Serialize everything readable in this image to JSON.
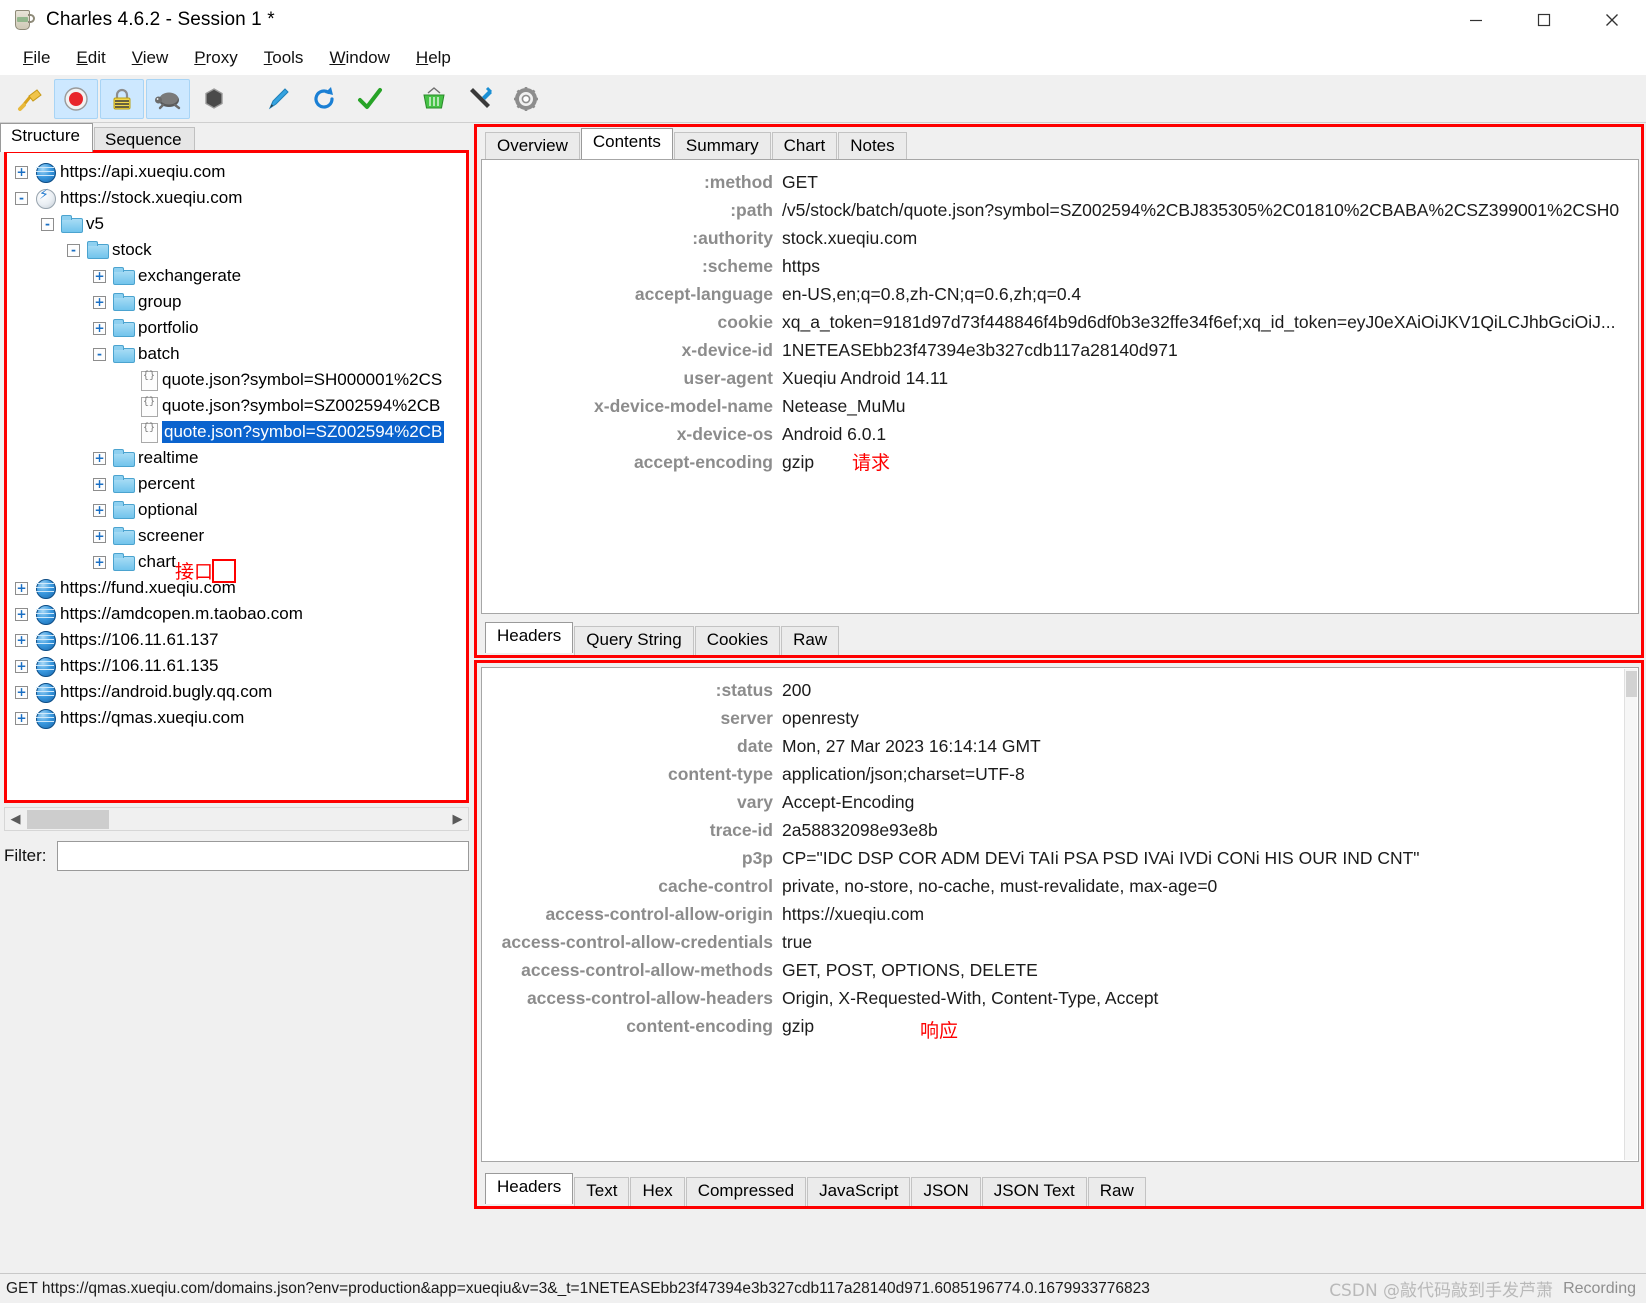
{
  "window": {
    "title": "Charles 4.6.2 - Session 1 *",
    "app_icon": "charles-jar-icon",
    "minimize": "minimize-button",
    "maximize": "maximize-button",
    "close": "close-button"
  },
  "menubar": [
    {
      "label": "File",
      "mnemonic": "F"
    },
    {
      "label": "Edit",
      "mnemonic": "E"
    },
    {
      "label": "View",
      "mnemonic": "V"
    },
    {
      "label": "Proxy",
      "mnemonic": "P"
    },
    {
      "label": "Tools",
      "mnemonic": "T"
    },
    {
      "label": "Window",
      "mnemonic": "W"
    },
    {
      "label": "Help",
      "mnemonic": "H"
    }
  ],
  "toolbar": [
    {
      "name": "clear-session-icon",
      "glyph": "🧹",
      "active": false
    },
    {
      "name": "record-icon",
      "glyph": "⏺",
      "active": true
    },
    {
      "name": "ssl-proxying-icon",
      "glyph": "🔒",
      "active": true
    },
    {
      "name": "throttle-icon",
      "glyph": "🐢",
      "active": true
    },
    {
      "name": "breakpoints-icon",
      "glyph": "⬣",
      "active": false
    },
    {
      "name": "compose-icon",
      "glyph": "🖊",
      "active": false
    },
    {
      "name": "repeat-icon",
      "glyph": "↻",
      "active": false
    },
    {
      "name": "validate-icon",
      "glyph": "✔",
      "active": false
    },
    {
      "name": "tools-basket-icon",
      "glyph": "🧺",
      "active": false
    },
    {
      "name": "settings-tools-icon",
      "glyph": "🛠",
      "active": false
    },
    {
      "name": "gear-icon",
      "glyph": "⚙",
      "active": false
    }
  ],
  "left_panel": {
    "tabs": [
      {
        "label": "Structure",
        "selected": true
      },
      {
        "label": "Sequence",
        "selected": false
      }
    ],
    "tree": [
      {
        "label": "https://api.xueqiu.com",
        "indent": 0,
        "expander": "+",
        "icon": "globe",
        "selected": false
      },
      {
        "label": "https://stock.xueqiu.com",
        "indent": 0,
        "expander": "-",
        "icon": "bolt",
        "selected": false
      },
      {
        "label": "v5",
        "indent": 1,
        "expander": "-",
        "icon": "folder",
        "selected": false
      },
      {
        "label": "stock",
        "indent": 2,
        "expander": "-",
        "icon": "folder",
        "selected": false
      },
      {
        "label": "exchangerate",
        "indent": 3,
        "expander": "+",
        "icon": "folder",
        "selected": false
      },
      {
        "label": "group",
        "indent": 3,
        "expander": "+",
        "icon": "folder",
        "selected": false
      },
      {
        "label": "portfolio",
        "indent": 3,
        "expander": "+",
        "icon": "folder",
        "selected": false
      },
      {
        "label": "batch",
        "indent": 3,
        "expander": "-",
        "icon": "folder",
        "selected": false
      },
      {
        "label": "quote.json?symbol=SH000001%2CS",
        "indent": 4,
        "expander": "",
        "icon": "json",
        "selected": false
      },
      {
        "label": "quote.json?symbol=SZ002594%2CB",
        "indent": 4,
        "expander": "",
        "icon": "json",
        "selected": false
      },
      {
        "label": "quote.json?symbol=SZ002594%2CB",
        "indent": 4,
        "expander": "",
        "icon": "json",
        "selected": true
      },
      {
        "label": "realtime",
        "indent": 3,
        "expander": "+",
        "icon": "folder",
        "selected": false
      },
      {
        "label": "percent",
        "indent": 3,
        "expander": "+",
        "icon": "folder",
        "selected": false
      },
      {
        "label": "optional",
        "indent": 3,
        "expander": "+",
        "icon": "folder",
        "selected": false
      },
      {
        "label": "screener",
        "indent": 3,
        "expander": "+",
        "icon": "folder",
        "selected": false
      },
      {
        "label": "chart",
        "indent": 3,
        "expander": "+",
        "icon": "folder",
        "selected": false
      },
      {
        "label": "https://fund.xueqiu.com",
        "indent": 0,
        "expander": "+",
        "icon": "globe",
        "selected": false
      },
      {
        "label": "https://amdcopen.m.taobao.com",
        "indent": 0,
        "expander": "+",
        "icon": "globe",
        "selected": false
      },
      {
        "label": "https://106.11.61.137",
        "indent": 0,
        "expander": "+",
        "icon": "globe",
        "selected": false
      },
      {
        "label": "https://106.11.61.135",
        "indent": 0,
        "expander": "+",
        "icon": "globe",
        "selected": false
      },
      {
        "label": "https://android.bugly.qq.com",
        "indent": 0,
        "expander": "+",
        "icon": "globe",
        "selected": false
      },
      {
        "label": "https://qmas.xueqiu.com",
        "indent": 0,
        "expander": "+",
        "icon": "globe",
        "selected": false
      }
    ],
    "annotation": "接口",
    "filter_label": "Filter:",
    "filter_value": "",
    "filter_placeholder": ""
  },
  "request_panel": {
    "tabs": [
      {
        "label": "Overview",
        "selected": false
      },
      {
        "label": "Contents",
        "selected": true
      },
      {
        "label": "Summary",
        "selected": false
      },
      {
        "label": "Chart",
        "selected": false
      },
      {
        "label": "Notes",
        "selected": false
      }
    ],
    "headers": [
      {
        "key": ":method",
        "value": "GET"
      },
      {
        "key": ":path",
        "value": "/v5/stock/batch/quote.json?symbol=SZ002594%2CBJ835305%2C01810%2CBABA%2CSZ399001%2CSH0"
      },
      {
        "key": ":authority",
        "value": "stock.xueqiu.com"
      },
      {
        "key": ":scheme",
        "value": "https"
      },
      {
        "key": "accept-language",
        "value": "en-US,en;q=0.8,zh-CN;q=0.6,zh;q=0.4"
      },
      {
        "key": "cookie",
        "value": "xq_a_token=9181d97d73f448846f4b9d6df0b3e32ffe34f6ef;xq_id_token=eyJ0eXAiOiJKV1QiLCJhbGciOiJ..."
      },
      {
        "key": "x-device-id",
        "value": "1NETEASEbb23f47394e3b327cdb117a28140d971"
      },
      {
        "key": "user-agent",
        "value": "Xueqiu Android 14.11"
      },
      {
        "key": "x-device-model-name",
        "value": "Netease_MuMu"
      },
      {
        "key": "x-device-os",
        "value": "Android 6.0.1"
      },
      {
        "key": "accept-encoding",
        "value": "gzip"
      }
    ],
    "annotation": "请求",
    "bottom_tabs": [
      {
        "label": "Headers",
        "selected": true
      },
      {
        "label": "Query String",
        "selected": false
      },
      {
        "label": "Cookies",
        "selected": false
      },
      {
        "label": "Raw",
        "selected": false
      }
    ]
  },
  "response_panel": {
    "headers": [
      {
        "key": ":status",
        "value": "200"
      },
      {
        "key": "server",
        "value": "openresty"
      },
      {
        "key": "date",
        "value": "Mon, 27 Mar 2023 16:14:14 GMT"
      },
      {
        "key": "content-type",
        "value": "application/json;charset=UTF-8"
      },
      {
        "key": "vary",
        "value": "Accept-Encoding"
      },
      {
        "key": "trace-id",
        "value": "2a58832098e93e8b"
      },
      {
        "key": "p3p",
        "value": "CP=\"IDC DSP COR ADM DEVi TAIi PSA PSD IVAi IVDi CONi HIS OUR IND CNT\""
      },
      {
        "key": "cache-control",
        "value": "private, no-store, no-cache, must-revalidate, max-age=0"
      },
      {
        "key": "access-control-allow-origin",
        "value": "https://xueqiu.com"
      },
      {
        "key": "access-control-allow-credentials",
        "value": "true"
      },
      {
        "key": "access-control-allow-methods",
        "value": "GET, POST, OPTIONS, DELETE"
      },
      {
        "key": "access-control-allow-headers",
        "value": "Origin, X-Requested-With, Content-Type, Accept"
      },
      {
        "key": "content-encoding",
        "value": "gzip"
      }
    ],
    "annotation": "响应",
    "bottom_tabs": [
      {
        "label": "Headers",
        "selected": true
      },
      {
        "label": "Text",
        "selected": false
      },
      {
        "label": "Hex",
        "selected": false
      },
      {
        "label": "Compressed",
        "selected": false
      },
      {
        "label": "JavaScript",
        "selected": false
      },
      {
        "label": "JSON",
        "selected": false
      },
      {
        "label": "JSON Text",
        "selected": false
      },
      {
        "label": "Raw",
        "selected": false
      }
    ]
  },
  "statusbar": {
    "text": "GET https://qmas.xueqiu.com/domains.json?env=production&app=xueqiu&v=3&_t=1NETEASEbb23f47394e3b327cdb117a28140d971.6085196774.0.1679933776823",
    "watermark": "CSDN @敲代码敲到手发芦萧",
    "recording": "Recording"
  },
  "colors": {
    "annotation_red": "#fe0000",
    "selection_blue": "#0a63ce",
    "key_gray": "#8c8c8c"
  }
}
